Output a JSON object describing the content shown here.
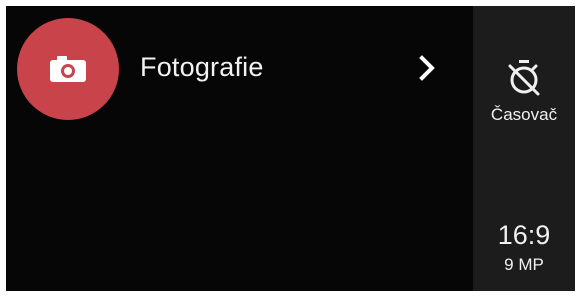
{
  "mode": {
    "icon": "camera-icon",
    "label": "Fotografie",
    "accent_color": "#c9434a",
    "chevron_icon": "chevron-right-icon"
  },
  "side_panel": {
    "timer": {
      "icon": "timer-off-icon",
      "label": "Časovač"
    },
    "aspect": {
      "ratio": "16:9",
      "resolution": "9 MP"
    }
  }
}
